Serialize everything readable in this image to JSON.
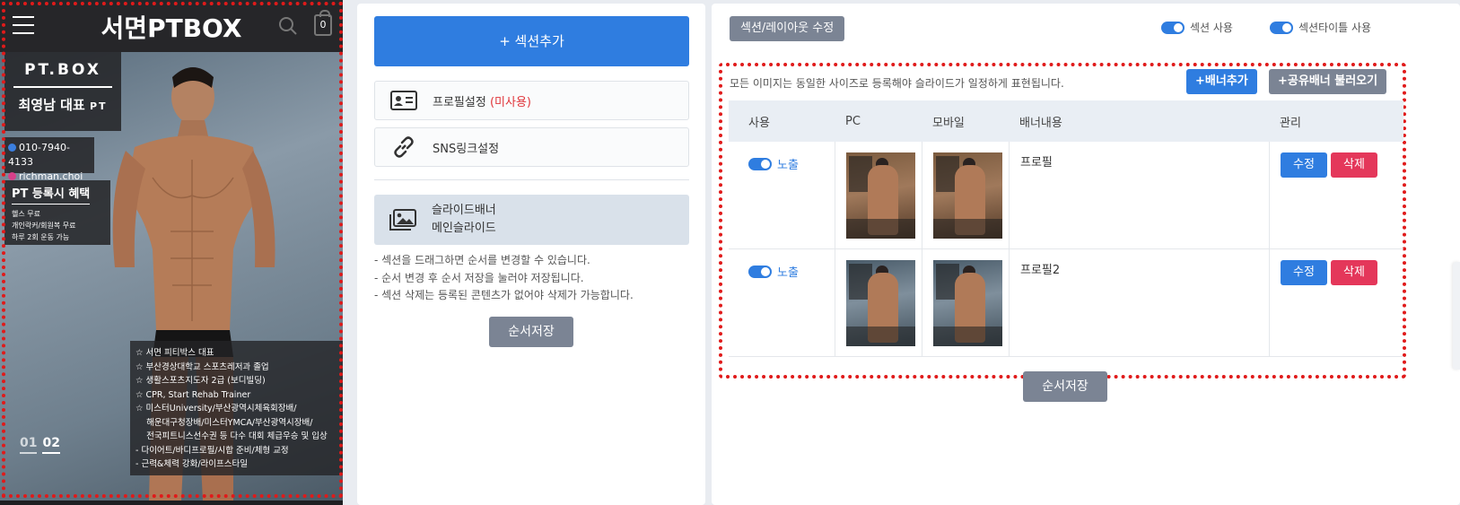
{
  "preview": {
    "brand": "서면PTBOX",
    "cart_count": "0",
    "logo_text": "PT.BOX",
    "trainer_name": "최영남 대표",
    "trainer_suffix": "PT",
    "phone": "010-7940-4133",
    "instagram": "richman.choi",
    "benefit_title": "PT 등록시 혜택",
    "benefits": [
      "헬스 무료",
      "개인락커/회원복 무료",
      "하루 2회 운동 가능"
    ],
    "career": [
      "☆ 서면 피티박스 대표",
      "☆ 부산경상대학교 스포츠레저과 졸업",
      "☆ 생활스포츠지도자 2급 (보디빌딩)",
      "☆ CPR, Start Rehab Trainer",
      "☆ 미스터University/부산광역시체육회장배/",
      "    해운대구청장배/미스터YMCA/부산광역시장배/",
      "    전국피트니스선수권 등 다수 대회 체급우승 및 입상",
      "- 다이어트/바디프로필/시합 준비/체형 교정",
      "- 근력&체력 강화/라이프스타일"
    ],
    "pager_1": "01",
    "pager_2": "02"
  },
  "sections": {
    "add_button": "+ 섹션추가",
    "profile_label": "프로필설정",
    "profile_status": "(미사용)",
    "sns_label": "SNS링크설정",
    "slide_line1": "슬라이드배너",
    "slide_line2": "메인슬라이드",
    "hints": [
      "- 섹션을 드래그하면 순서를 변경할 수 있습니다.",
      "- 순서 변경 후 순서 저장을 눌러야 저장됩니다.",
      "- 섹션 삭제는 등록된 콘텐츠가 없어야 삭제가 가능합니다."
    ],
    "save_order": "순서저장"
  },
  "editor": {
    "edit_title": "섹션/레이아웃 수정",
    "toggle_section": "섹션 사용",
    "toggle_section_title": "섹션타이틀 사용",
    "note": "모든 이미지는 동일한 사이즈로 등록해야 슬라이드가 일정하게 표현됩니다.",
    "add_banner": "+배너추가",
    "load_shared_banner": "+공유배너 불러오기",
    "columns": [
      "사용",
      "PC",
      "모바일",
      "배너내용",
      "관리"
    ],
    "rows": [
      {
        "show_label": "노출",
        "content": "프로필",
        "edit": "수정",
        "delete": "삭제"
      },
      {
        "show_label": "노출",
        "content": "프로필2",
        "edit": "수정",
        "delete": "삭제"
      }
    ],
    "save_order": "순서저장"
  },
  "colors": {
    "primary": "#2f7de0",
    "danger": "#e4375a",
    "neutral": "#7b8494",
    "highlight_border": "#e01a1a"
  }
}
